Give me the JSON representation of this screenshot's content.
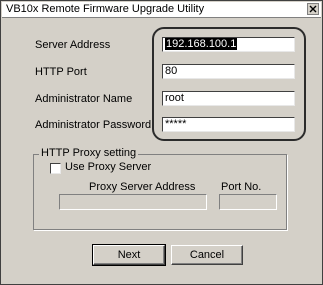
{
  "window": {
    "title": "VB10x Remote Firmware Upgrade Utility"
  },
  "form": {
    "server_address": {
      "label": "Server Address",
      "value": "192.168.100.1"
    },
    "http_port": {
      "label": "HTTP Port",
      "value": "80"
    },
    "admin_name": {
      "label": "Administrator Name",
      "value": "root"
    },
    "admin_password": {
      "label": "Administrator Password",
      "value": "*****"
    }
  },
  "proxy": {
    "group_title": "HTTP Proxy setting",
    "use_proxy_label": "Use Proxy Server",
    "use_proxy_checked": false,
    "address_label": "Proxy Server Address",
    "port_label": "Port No.",
    "address_value": "",
    "port_value": ""
  },
  "buttons": {
    "next": "Next",
    "cancel": "Cancel"
  }
}
